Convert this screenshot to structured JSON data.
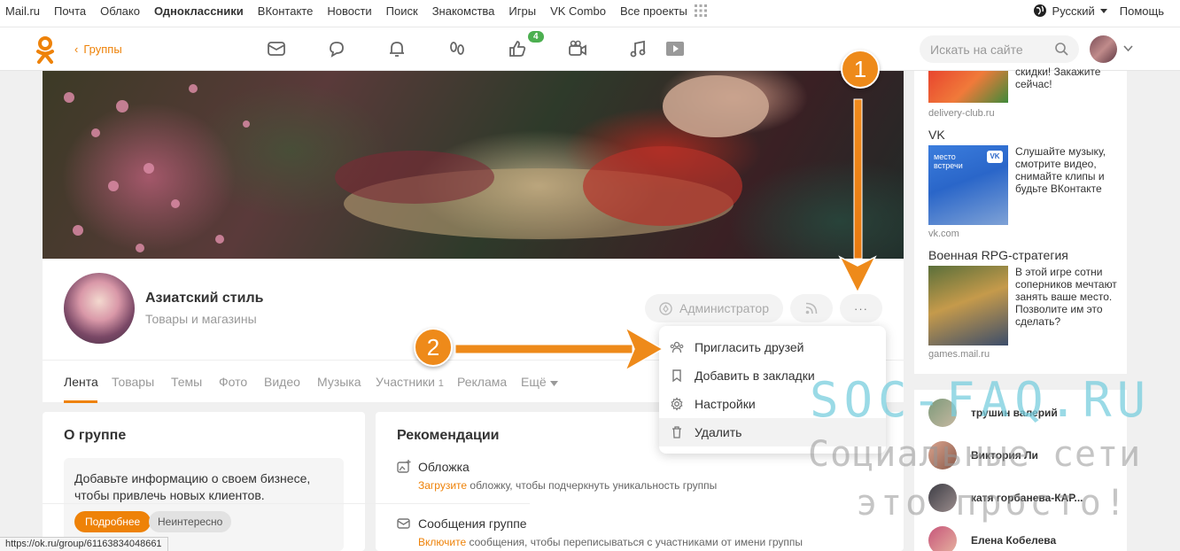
{
  "portal": {
    "links": [
      "Mail.ru",
      "Почта",
      "Облако",
      "Одноклассники",
      "ВКонтакте",
      "Новости",
      "Поиск",
      "Знакомства",
      "Игры",
      "VK Combo",
      "Все проекты"
    ],
    "language": "Русский",
    "help": "Помощь"
  },
  "nav": {
    "back_label": "Группы",
    "likes_badge": "4",
    "search_placeholder": "Искать на сайте"
  },
  "group": {
    "name": "Азиатский стиль",
    "category": "Товары и магазины",
    "admin_label": "Администратор",
    "more_label": "···"
  },
  "tabs": [
    "Лента",
    "Товары",
    "Темы",
    "Фото",
    "Видео",
    "Музыка",
    "Участники",
    "Реклама",
    "Ещё"
  ],
  "members_count": "1",
  "menu": {
    "items": [
      "Пригласить друзей",
      "Добавить в закладки",
      "Настройки",
      "Удалить"
    ]
  },
  "about": {
    "title": "О группе",
    "text": "Добавьте информацию о своем бизнесе, чтобы привлечь новых клиентов.",
    "more_btn": "Подробнее",
    "not_interested_btn": "Неинтересно"
  },
  "recommendations": {
    "title": "Рекомендации",
    "items": [
      {
        "title": "Обложка",
        "action": "Загрузите",
        "desc": " обложку, чтобы подчеркнуть уникальность группы"
      },
      {
        "title": "Сообщения группе",
        "action": "Включите",
        "desc": " сообщения, чтобы переписываться с участниками от имени группы"
      }
    ]
  },
  "ads": [
    {
      "title": "",
      "text": "скидки! Закажите сейчас!",
      "domain": "delivery-club.ru"
    },
    {
      "title": "VK",
      "text": "Слушайте музыку, смотрите видео, снимайте клипы и будьте ВКонтакте",
      "domain": "vk.com"
    },
    {
      "title": "Военная RPG-стратегия",
      "text": "В этой игре сотни соперников мечтают занять ваше место. Позволите им это сделать?",
      "domain": "games.mail.ru"
    }
  ],
  "vk_ad_img_text": "место встречи",
  "friends": [
    "трушин валерий",
    "Виктория Ли",
    "катя горбанева-КАР...",
    "Елена Кобелева"
  ],
  "watermark": {
    "line1": "SOC-FAQ.RU",
    "line2": "Социальные сети",
    "line3": "это просто!"
  },
  "markers": [
    "1",
    "2"
  ],
  "status_url": "https://ok.ru/group/61163834048661",
  "colors": {
    "accent": "#ee8208",
    "badge": "#4caf50",
    "marker": "#ee8a1a",
    "watermark_teal": "#78cdde"
  }
}
